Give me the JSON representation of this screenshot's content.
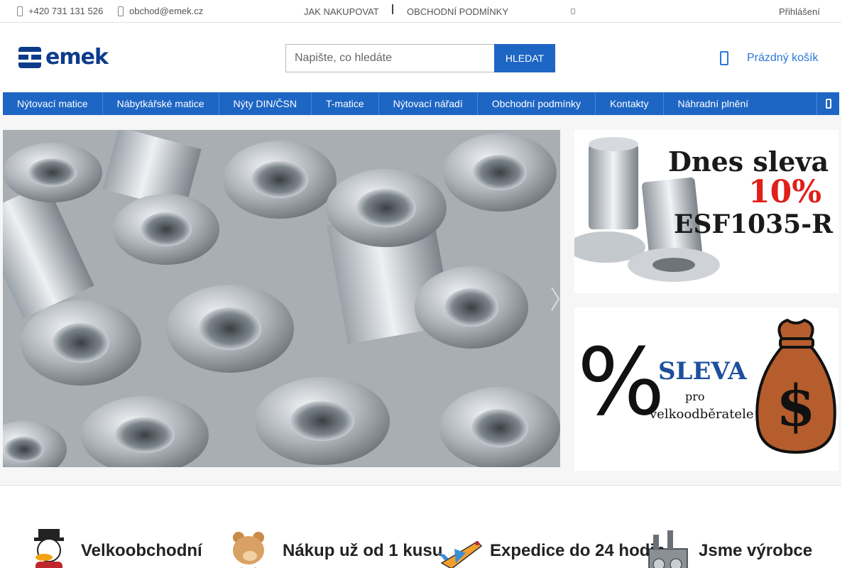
{
  "topbar": {
    "phone": "+420 731 131 526",
    "email": "obchod@emek.cz",
    "links": [
      "JAK NAKUPOVAT",
      "OBCHODNÍ PODMÍNKY"
    ],
    "login": "Přihlášení"
  },
  "header": {
    "logo_text": "emek",
    "search_placeholder": "Napište, co hledáte",
    "search_button": "HLEDAT",
    "cart_label": "Prázdný košík"
  },
  "nav": {
    "items": [
      "Nýtovací matice",
      "Nábytkářské matice",
      "Nýty DIN/ČSN",
      "T-matice",
      "Nýtovací nářadí",
      "Obchodní podmínky",
      "Kontakty",
      "Náhradní plnění"
    ]
  },
  "promos": {
    "promo1": {
      "line1": "Dnes sleva",
      "line2": "10%",
      "line3": "ESF1035-R"
    },
    "promo2": {
      "symbol": "%",
      "line1": "SLEVA",
      "line2": "pro",
      "line3": "velkoodběratele",
      "bag_symbol": "$"
    }
  },
  "benefits": [
    {
      "text": "Velkoobchodní"
    },
    {
      "text": "Nákup už od 1 kusu"
    },
    {
      "text": "Expedice do 24 hodin"
    },
    {
      "text": "Jsme výrobce"
    }
  ],
  "colors": {
    "brand": "#1e66c4",
    "logo": "#0d3b8c",
    "cart": "#2b78d6",
    "promo_red": "#e0201a",
    "promo_blue": "#1d4f9c"
  }
}
